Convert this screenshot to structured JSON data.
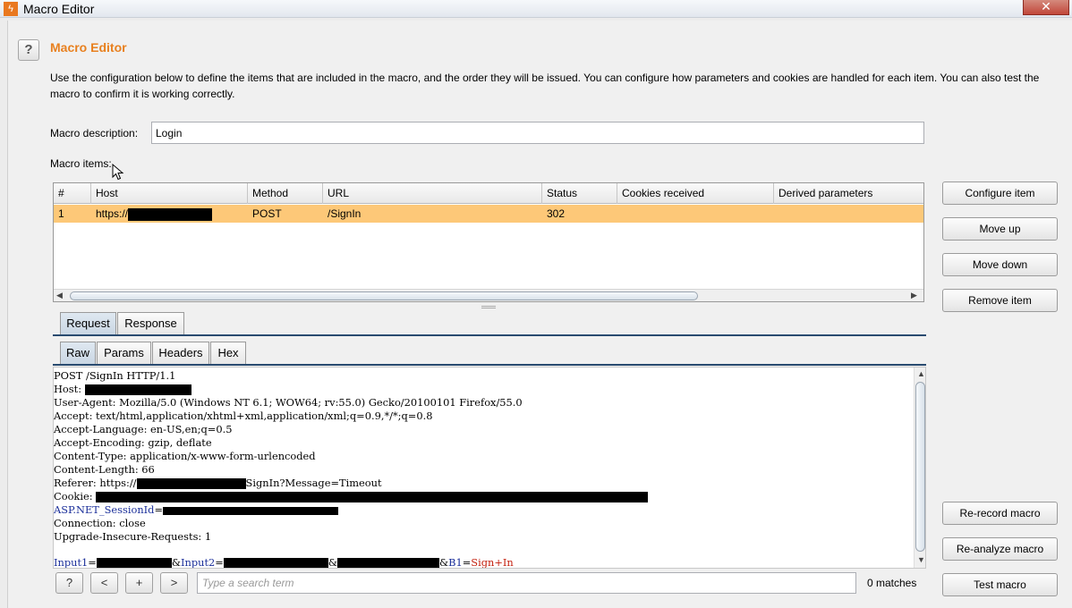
{
  "window": {
    "title": "Macro Editor"
  },
  "header": {
    "title": "Macro Editor",
    "description": "Use the configuration below to define the items that are included in the macro, and the order they will be issued. You can configure how parameters and cookies are handled for each item. You can also test the macro to confirm it is working correctly."
  },
  "form": {
    "description_label": "Macro description:",
    "description_value": "Login",
    "items_label": "Macro items:"
  },
  "table": {
    "columns": [
      "#",
      "Host",
      "Method",
      "URL",
      "Status",
      "Cookies received",
      "Derived parameters"
    ],
    "rows": [
      {
        "num": "1",
        "host_prefix": "https://",
        "method": "POST",
        "url": "/SignIn",
        "status": "302",
        "cookies": "",
        "derived": ""
      }
    ]
  },
  "side_buttons": {
    "configure": "Configure item",
    "move_up": "Move up",
    "move_down": "Move down",
    "remove": "Remove item",
    "rerecord": "Re-record macro",
    "reanalyze": "Re-analyze macro",
    "test": "Test macro"
  },
  "tabs": {
    "outer": [
      "Request",
      "Response"
    ],
    "inner": [
      "Raw",
      "Params",
      "Headers",
      "Hex"
    ]
  },
  "request": {
    "request_line": "POST /SignIn HTTP/1.1",
    "host_label": "Host: ",
    "user_agent": "User-Agent: Mozilla/5.0 (Windows NT 6.1; WOW64; rv:55.0) Gecko/20100101 Firefox/55.0",
    "accept": "Accept: text/html,application/xhtml+xml,application/xml;q=0.9,*/*;q=0.8",
    "accept_language": "Accept-Language: en-US,en;q=0.5",
    "accept_encoding": "Accept-Encoding: gzip, deflate",
    "content_type": "Content-Type: application/x-www-form-urlencoded",
    "content_length": "Content-Length: 66",
    "referer_prefix": "Referer: https://",
    "referer_suffix": "SignIn?Message=Timeout",
    "cookie_label": "Cookie: ",
    "session_name": "ASP.NET_SessionId",
    "session_eq": "=",
    "connection": "Connection: close",
    "upgrade": "Upgrade-Insecure-Requests: 1",
    "body_input1": "Input1",
    "body_eq1": "=",
    "body_amp1": "&",
    "body_input2": "Input2",
    "body_eq2": "=",
    "body_amp2": "&",
    "body_amp3": "&",
    "body_b1": "B1",
    "body_eq3": "=",
    "body_b1_val": "Sign+In"
  },
  "search": {
    "help_label": "?",
    "prev_label": "<",
    "add_label": "+",
    "next_label": ">",
    "placeholder": "Type a search term",
    "matches": "0 matches"
  },
  "top_help_label": "?",
  "close_label": "✕",
  "colors": {
    "heading": "#e8801f",
    "selected_row": "#fdc878",
    "param_name": "#1b2f9a",
    "param_value": "#c4200f"
  }
}
